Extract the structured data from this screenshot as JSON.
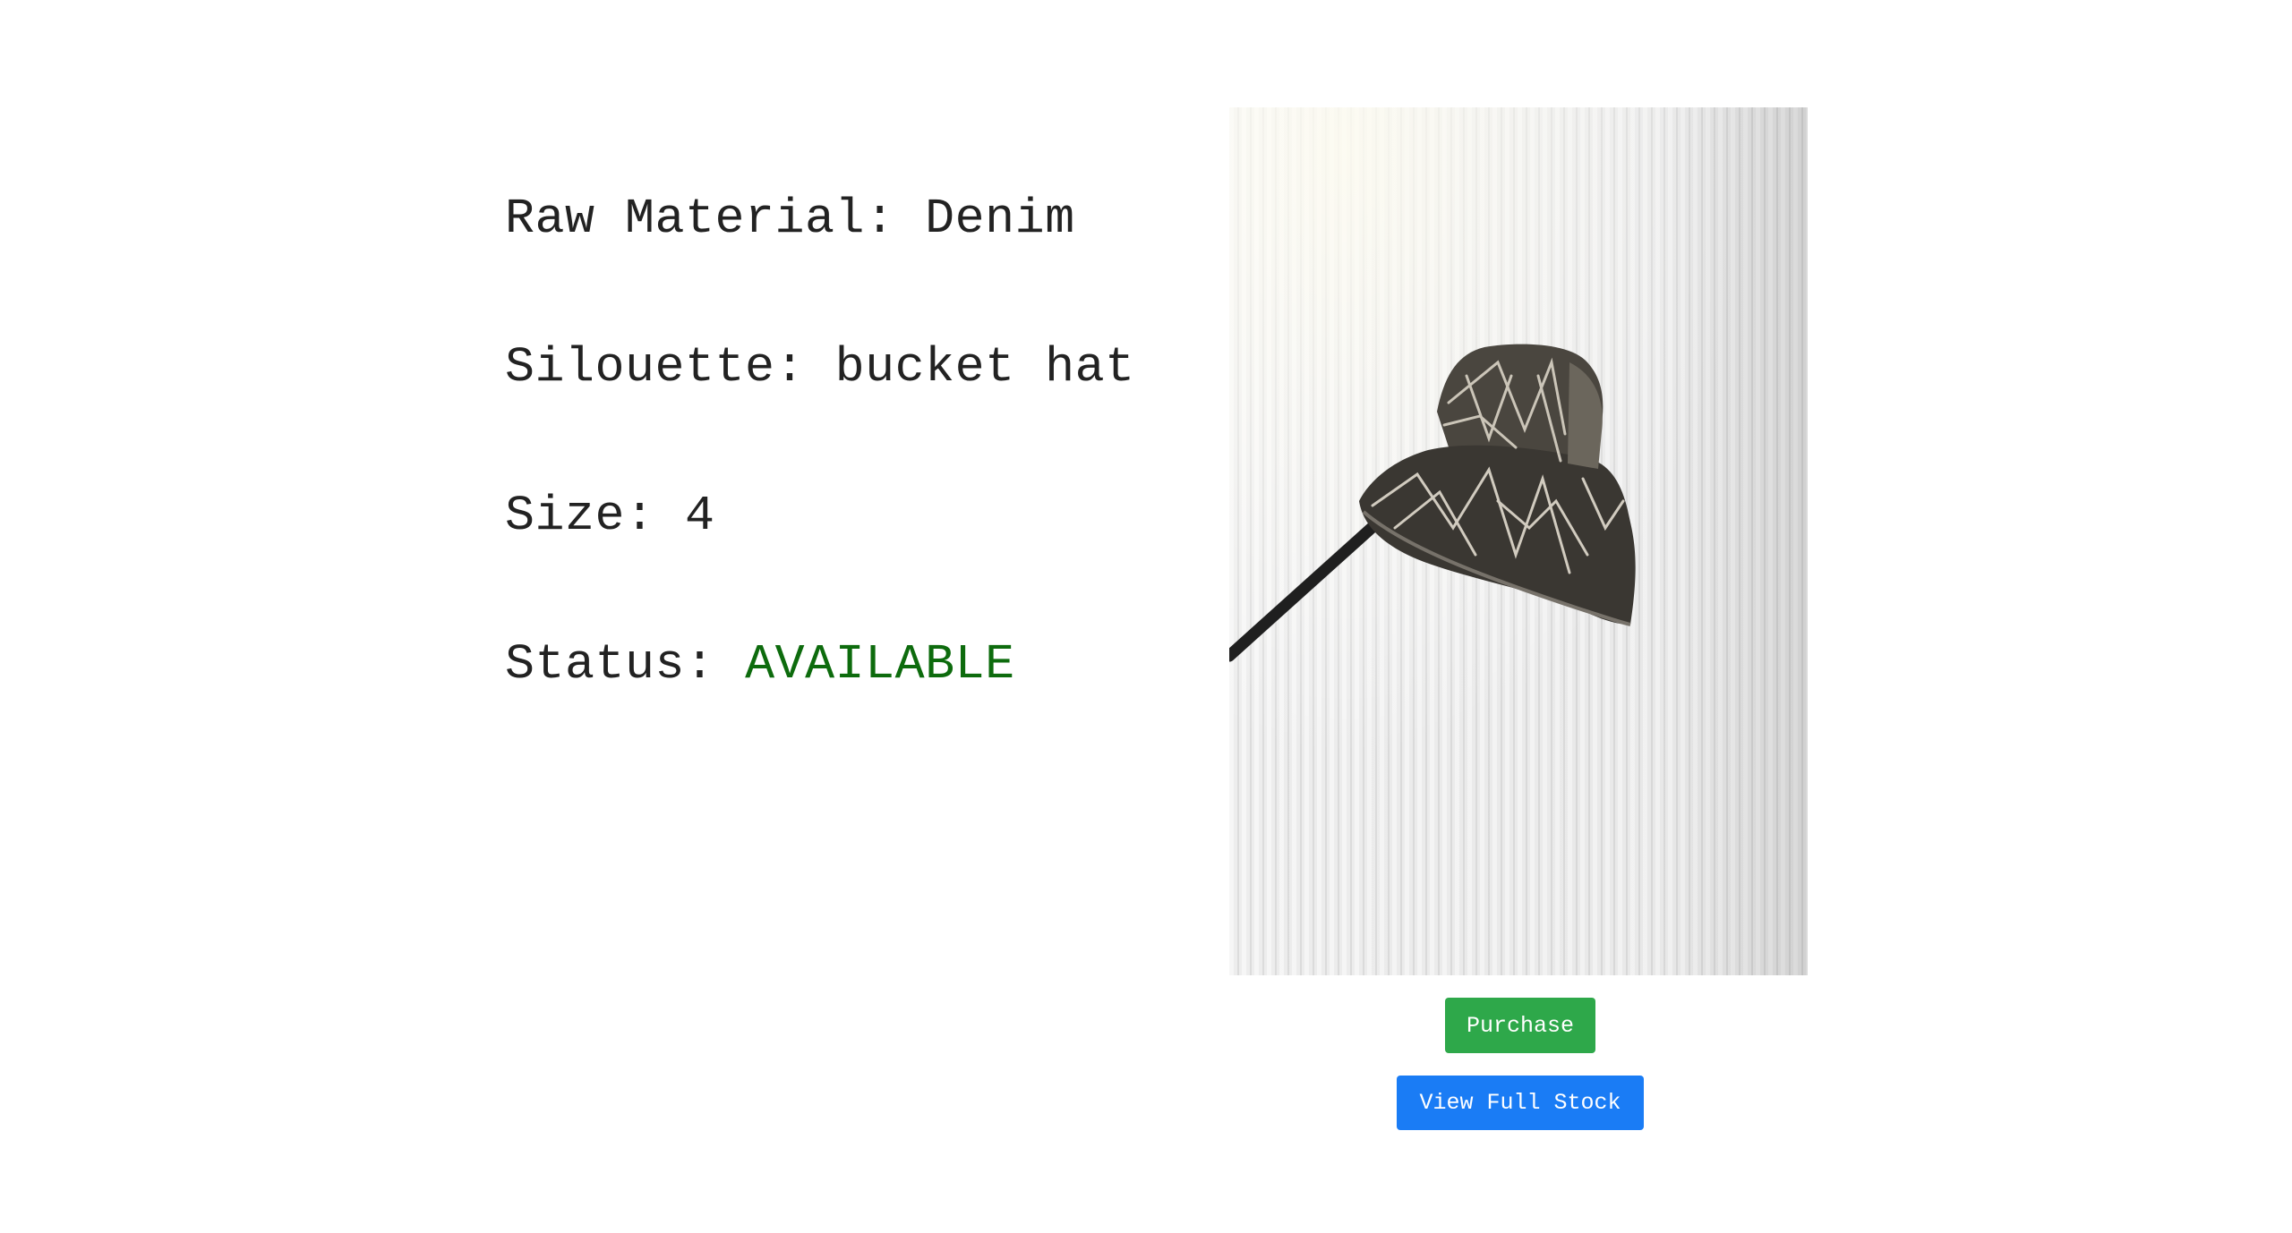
{
  "product": {
    "material_label": "Raw Material:",
    "material_value": "Denim",
    "silhouette_label": "Silouette:",
    "silhouette_value": "bucket hat",
    "size_label": "Size:",
    "size_value": "4",
    "status_label": "Status:",
    "status_value": "AVAILABLE"
  },
  "colors": {
    "text": "#222222",
    "status_available": "#0d6b0d",
    "purchase_button": "#2ea84a",
    "stock_button": "#1a7cf5"
  },
  "actions": {
    "purchase_label": "Purchase",
    "view_stock_label": "View Full Stock"
  }
}
